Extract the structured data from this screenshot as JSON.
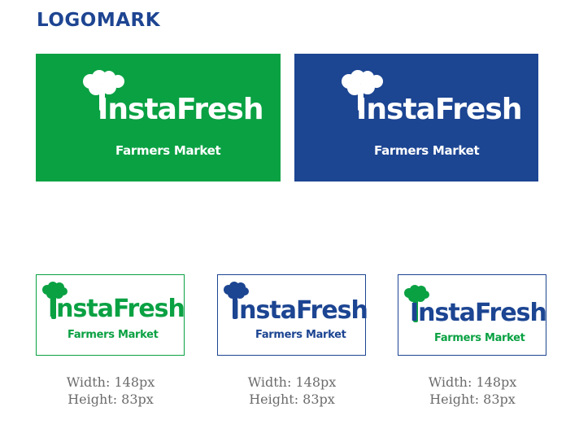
{
  "section_title": "LOGOMARK",
  "brand": {
    "name": "InstaFresh",
    "tagline": "Farmers Market"
  },
  "colors": {
    "green": "#0aa143",
    "blue": "#1c4592",
    "white": "#ffffff",
    "caption_gray": "#6b6b6b"
  },
  "logo_variants": [
    {
      "style": "white-on-green",
      "icon": "tree-icon"
    },
    {
      "style": "white-on-blue",
      "icon": "tree-icon"
    },
    {
      "style": "green-on-white",
      "icon": "tree-icon"
    },
    {
      "style": "blue-on-white",
      "icon": "tree-icon"
    },
    {
      "style": "mixed-green-blue-on-white",
      "icon": "tree-icon"
    }
  ],
  "captions": [
    {
      "width": "Width: 148px",
      "height": "Height: 83px"
    },
    {
      "width": "Width: 148px",
      "height": "Height: 83px"
    },
    {
      "width": "Width: 148px",
      "height": "Height: 83px"
    }
  ]
}
